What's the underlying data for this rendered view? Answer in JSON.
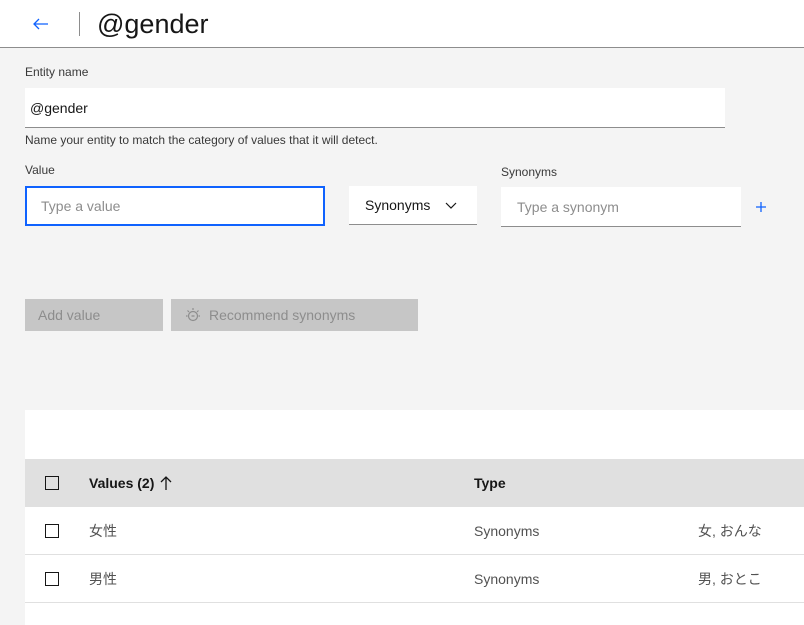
{
  "header": {
    "title": "@gender"
  },
  "entity": {
    "label": "Entity name",
    "value": "@gender",
    "helper": "Name your entity to match the category of values that it will detect."
  },
  "value_field": {
    "label": "Value",
    "placeholder": "Type a value"
  },
  "type_dropdown": {
    "selected": "Synonyms"
  },
  "synonyms_field": {
    "label": "Synonyms",
    "placeholder": "Type a synonym"
  },
  "actions": {
    "add_value": "Add value",
    "recommend": "Recommend synonyms"
  },
  "table": {
    "headers": {
      "values": "Values (2)",
      "type": "Type"
    },
    "rows": [
      {
        "value": "女性",
        "type": "Synonyms",
        "synonyms": "女, おんな"
      },
      {
        "value": "男性",
        "type": "Synonyms",
        "synonyms": "男, おとこ"
      }
    ]
  },
  "colors": {
    "accent": "#0f62fe",
    "disabled_bg": "#c6c6c6",
    "disabled_text": "#8d8d8d",
    "table_header": "#e0e0e0"
  }
}
